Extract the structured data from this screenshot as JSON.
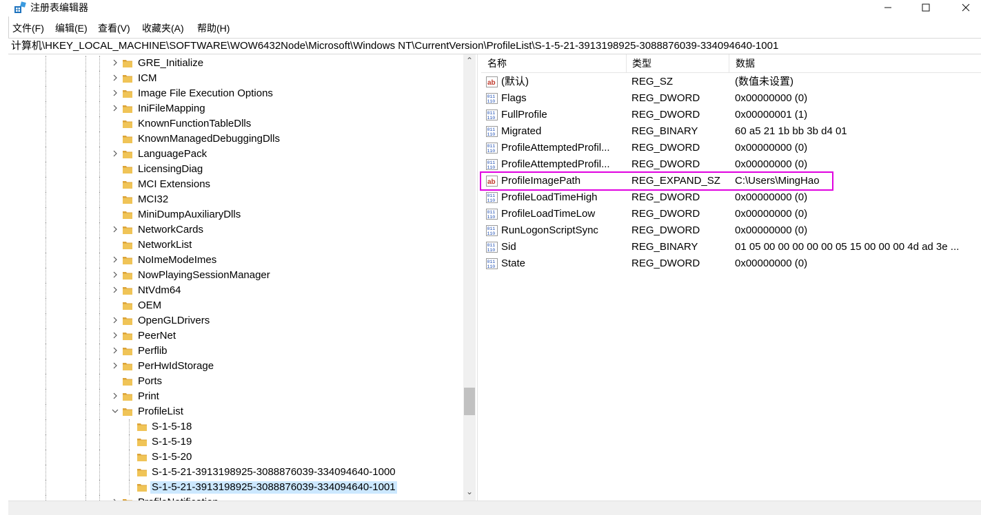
{
  "window": {
    "title": "注册表编辑器"
  },
  "menu": [
    "文件(F)",
    "编辑(E)",
    "查看(V)",
    "收藏夹(A)",
    "帮助(H)"
  ],
  "address": "计算机\\HKEY_LOCAL_MACHINE\\SOFTWARE\\WOW6432Node\\Microsoft\\Windows NT\\CurrentVersion\\ProfileList\\S-1-5-21-3913198925-3088876039-334094640-1001",
  "tree": [
    {
      "label": "GRE_Initialize",
      "expander": "collapsed"
    },
    {
      "label": "ICM",
      "expander": "collapsed"
    },
    {
      "label": "Image File Execution Options",
      "expander": "collapsed"
    },
    {
      "label": "IniFileMapping",
      "expander": "collapsed"
    },
    {
      "label": "KnownFunctionTableDlls",
      "expander": "none"
    },
    {
      "label": "KnownManagedDebuggingDlls",
      "expander": "none"
    },
    {
      "label": "LanguagePack",
      "expander": "collapsed"
    },
    {
      "label": "LicensingDiag",
      "expander": "none"
    },
    {
      "label": "MCI Extensions",
      "expander": "none"
    },
    {
      "label": "MCI32",
      "expander": "none"
    },
    {
      "label": "MiniDumpAuxiliaryDlls",
      "expander": "none"
    },
    {
      "label": "NetworkCards",
      "expander": "collapsed"
    },
    {
      "label": "NetworkList",
      "expander": "none"
    },
    {
      "label": "NoImeModeImes",
      "expander": "collapsed"
    },
    {
      "label": "NowPlayingSessionManager",
      "expander": "collapsed"
    },
    {
      "label": "NtVdm64",
      "expander": "collapsed"
    },
    {
      "label": "OEM",
      "expander": "none"
    },
    {
      "label": "OpenGLDrivers",
      "expander": "collapsed"
    },
    {
      "label": "PeerNet",
      "expander": "collapsed"
    },
    {
      "label": "Perflib",
      "expander": "collapsed"
    },
    {
      "label": "PerHwIdStorage",
      "expander": "collapsed"
    },
    {
      "label": "Ports",
      "expander": "none"
    },
    {
      "label": "Print",
      "expander": "collapsed"
    },
    {
      "label": "ProfileList",
      "expander": "expanded"
    },
    {
      "label": "S-1-5-18",
      "expander": "child"
    },
    {
      "label": "S-1-5-19",
      "expander": "child"
    },
    {
      "label": "S-1-5-20",
      "expander": "child"
    },
    {
      "label": "S-1-5-21-3913198925-3088876039-334094640-1000",
      "expander": "child"
    },
    {
      "label": "S-1-5-21-3913198925-3088876039-334094640-1001",
      "expander": "child",
      "selected": true
    },
    {
      "label": "ProfileNotification",
      "expander": "collapsed"
    }
  ],
  "columns": {
    "name": "名称",
    "type": "类型",
    "data": "数据"
  },
  "values": [
    {
      "icon": "string-value-icon",
      "name": "(默认)",
      "type": "REG_SZ",
      "data": "(数值未设置)"
    },
    {
      "icon": "binary-value-icon",
      "name": "Flags",
      "type": "REG_DWORD",
      "data": "0x00000000 (0)"
    },
    {
      "icon": "binary-value-icon",
      "name": "FullProfile",
      "type": "REG_DWORD",
      "data": "0x00000001 (1)"
    },
    {
      "icon": "binary-value-icon",
      "name": "Migrated",
      "type": "REG_BINARY",
      "data": "60 a5 21 1b bb 3b d4 01"
    },
    {
      "icon": "binary-value-icon",
      "name": "ProfileAttemptedProfil...",
      "type": "REG_DWORD",
      "data": "0x00000000 (0)"
    },
    {
      "icon": "binary-value-icon",
      "name": "ProfileAttemptedProfil...",
      "type": "REG_DWORD",
      "data": "0x00000000 (0)"
    },
    {
      "icon": "string-value-icon",
      "name": "ProfileImagePath",
      "type": "REG_EXPAND_SZ",
      "data": "C:\\Users\\MingHao",
      "highlighted": true
    },
    {
      "icon": "binary-value-icon",
      "name": "ProfileLoadTimeHigh",
      "type": "REG_DWORD",
      "data": "0x00000000 (0)"
    },
    {
      "icon": "binary-value-icon",
      "name": "ProfileLoadTimeLow",
      "type": "REG_DWORD",
      "data": "0x00000000 (0)"
    },
    {
      "icon": "binary-value-icon",
      "name": "RunLogonScriptSync",
      "type": "REG_DWORD",
      "data": "0x00000000 (0)"
    },
    {
      "icon": "binary-value-icon",
      "name": "Sid",
      "type": "REG_BINARY",
      "data": "01 05 00 00 00 00 00 05 15 00 00 00 4d ad 3e ..."
    },
    {
      "icon": "binary-value-icon",
      "name": "State",
      "type": "REG_DWORD",
      "data": "0x00000000 (0)"
    }
  ],
  "colors": {
    "selection": "#cce8ff",
    "highlight_box": "#e000e0",
    "folder": "#e8b84a"
  }
}
